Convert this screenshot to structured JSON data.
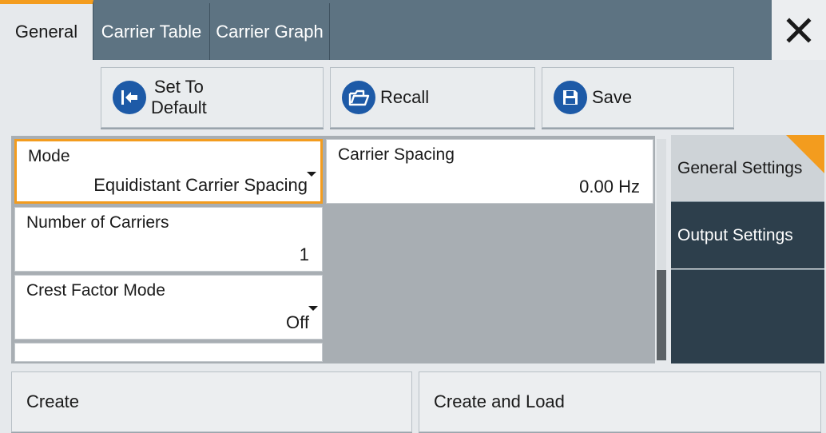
{
  "tabs": [
    {
      "label": "General",
      "active": true
    },
    {
      "label": "Carrier Table",
      "active": false
    },
    {
      "label": "Carrier Graph",
      "active": false
    }
  ],
  "close_icon": "close-x-icon",
  "toolbar": {
    "set_default": {
      "line1": "Set To",
      "line2": "Default",
      "icon": "arrow-left-bar-icon"
    },
    "recall": {
      "label": "Recall",
      "icon": "folder-open-icon"
    },
    "save": {
      "label": "Save",
      "icon": "floppy-disk-icon"
    }
  },
  "fields": {
    "mode": {
      "label": "Mode",
      "value": "Equidistant Carrier Spacing"
    },
    "carrier_spacing": {
      "label": "Carrier Spacing",
      "value": "0.00 Hz"
    },
    "num_carriers": {
      "label": "Number of Carriers",
      "value": "1"
    },
    "crest_factor": {
      "label": "Crest Factor Mode",
      "value": "Off"
    }
  },
  "side_nav": {
    "general": "General Settings",
    "output": "Output Settings"
  },
  "bottom": {
    "create": "Create",
    "create_load": "Create and Load"
  },
  "colors": {
    "accent": "#f39c1e",
    "tab_bar": "#5d7382",
    "nav_dark": "#2d3f4c",
    "icon_blue": "#1d5aa7"
  }
}
